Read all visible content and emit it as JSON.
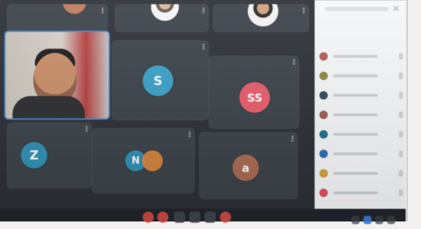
{
  "colors": {
    "tile_bg": "#3a4148",
    "monitor_bg": "#2b2f36",
    "sidebar_bg": "#f6f7f9",
    "accent_teal": "#3aa0c8",
    "accent_pink": "#e95b6b",
    "accent_orange": "#e38a3a",
    "accent_brown": "#a86a52",
    "red": "#d54c45"
  },
  "grid": {
    "participants": [
      {
        "id": "p-top-left",
        "name": ""
      },
      {
        "id": "p-top-mid",
        "name": ""
      },
      {
        "id": "p-top-right",
        "name": ""
      },
      {
        "id": "p-camera",
        "name": ""
      },
      {
        "id": "p-s",
        "name": "",
        "initial": "S"
      },
      {
        "id": "p-ss",
        "name": "",
        "initial": "SS"
      },
      {
        "id": "p-z",
        "name": "",
        "initial": "Z"
      },
      {
        "id": "p-n",
        "name": "",
        "initial": "N"
      },
      {
        "id": "p-a",
        "name": "",
        "initial": "a"
      }
    ]
  },
  "sidebar": {
    "title": "",
    "rows": [
      {
        "icon": "avatar-icon",
        "color": "#b85a56"
      },
      {
        "icon": "avatar-icon",
        "color": "#8f8a3c"
      },
      {
        "icon": "avatar-icon",
        "color": "#30495c"
      },
      {
        "icon": "avatar-icon",
        "color": "#a35952"
      },
      {
        "icon": "avatar-icon",
        "color": "#1f6f8b"
      },
      {
        "icon": "avatar-icon",
        "color": "#2d6fb6"
      },
      {
        "icon": "avatar-icon",
        "color": "#d7a534"
      },
      {
        "icon": "avatar-icon",
        "color": "#e24b66"
      }
    ]
  },
  "bottom_controls": [
    {
      "name": "mic-button",
      "icon": "microphone-icon"
    },
    {
      "name": "camera-button",
      "icon": "video-camera-icon"
    },
    {
      "name": "present-button",
      "icon": "present-screen-icon"
    },
    {
      "name": "raise-hand-button",
      "icon": "hand-icon"
    },
    {
      "name": "more-button",
      "icon": "more-options-icon"
    },
    {
      "name": "leave-button",
      "icon": "phone-hangup-icon"
    }
  ]
}
